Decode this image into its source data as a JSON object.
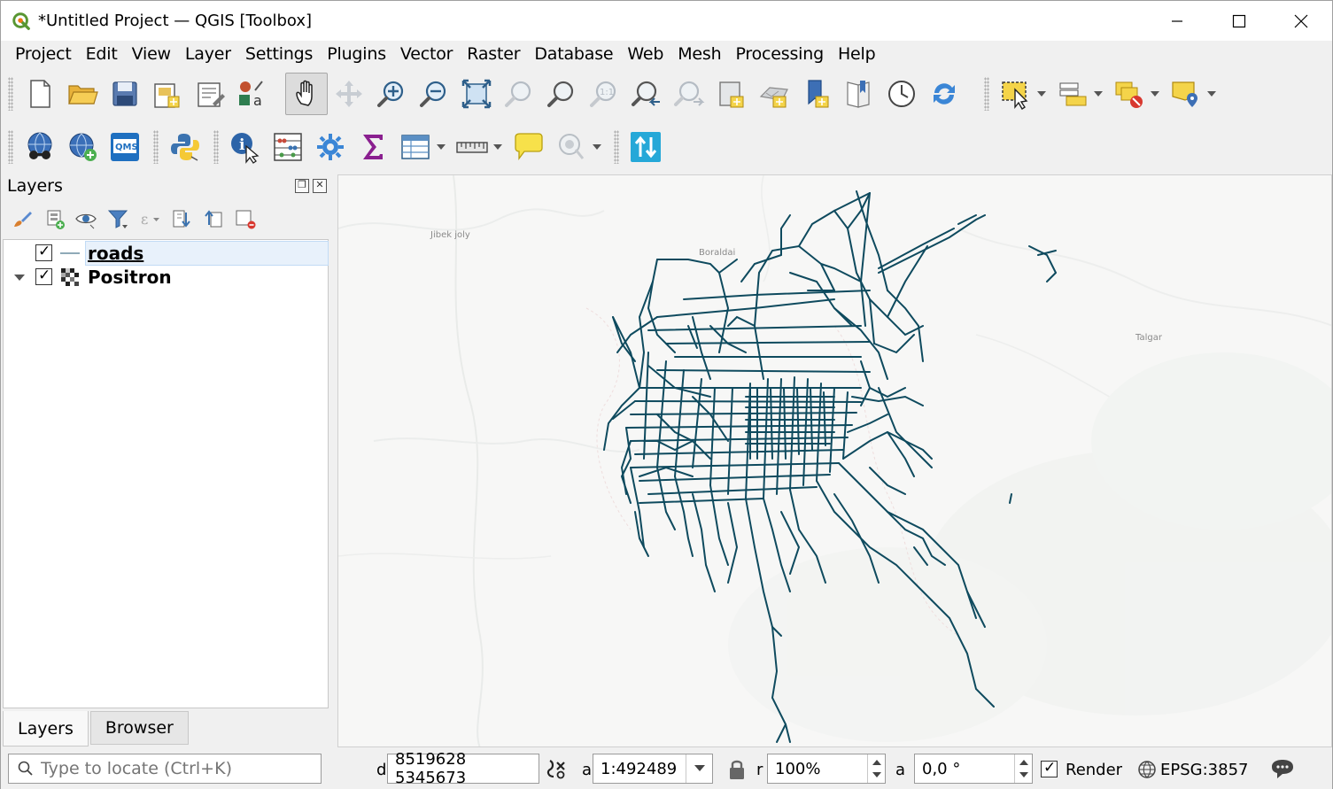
{
  "window": {
    "title": "*Untitled Project — QGIS [Toolbox]"
  },
  "menu": [
    "Project",
    "Edit",
    "View",
    "Layer",
    "Settings",
    "Plugins",
    "Vector",
    "Raster",
    "Database",
    "Web",
    "Mesh",
    "Processing",
    "Help"
  ],
  "layers_panel": {
    "title": "Layers",
    "layers": [
      {
        "name": "roads",
        "checked": true,
        "type": "line",
        "selected": true
      },
      {
        "name": "Positron",
        "checked": true,
        "type": "raster",
        "selected": false
      }
    ],
    "tabs": [
      "Layers",
      "Browser"
    ]
  },
  "map": {
    "labels": {
      "jibek": "Jibek joly",
      "boraldai": "Boraldai",
      "talgar": "Talgar"
    },
    "road_color": "#0e4a5e",
    "background": "#f7f7f6"
  },
  "statusbar": {
    "locate_placeholder": "Type to locate (Ctrl+K)",
    "coord_label": "d",
    "coordinates": "8519628  5345673",
    "scale_label": "a",
    "scale": "1:492489",
    "magnifier_label": "r",
    "magnifier": "100%",
    "rotation_label": "a",
    "rotation": "0,0 °",
    "render_label": "Render",
    "crs": "EPSG:3857"
  }
}
